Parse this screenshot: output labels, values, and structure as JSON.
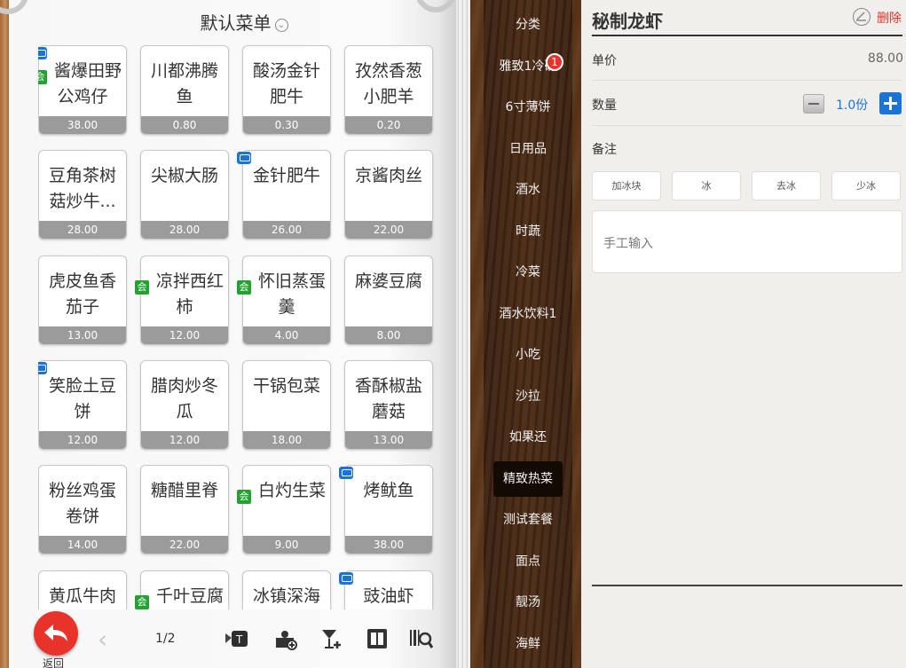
{
  "menu": {
    "title": "默认菜单"
  },
  "dishes": [
    {
      "name": "酱爆田野公鸡仔",
      "price": "38.00",
      "blue": true,
      "green": true
    },
    {
      "name": "川都沸腾鱼",
      "price": "0.80",
      "blue": false,
      "green": false
    },
    {
      "name": "酸汤金针肥牛",
      "price": "0.30",
      "blue": false,
      "green": false
    },
    {
      "name": "孜然香葱小肥羊",
      "price": "0.20",
      "blue": false,
      "green": false
    },
    {
      "name": "豆角茶树菇炒牛...",
      "price": "28.00",
      "blue": false,
      "green": false
    },
    {
      "name": "尖椒大肠",
      "price": "28.00",
      "blue": false,
      "green": false
    },
    {
      "name": "金针肥牛",
      "price": "26.00",
      "blue": true,
      "green": false
    },
    {
      "name": "京酱肉丝",
      "price": "22.00",
      "blue": false,
      "green": false
    },
    {
      "name": "虎皮鱼香茄子",
      "price": "13.00",
      "blue": false,
      "green": false
    },
    {
      "name": "凉拌西红柿",
      "price": "12.00",
      "blue": false,
      "green": true
    },
    {
      "name": "怀旧蒸蛋羹",
      "price": "4.00",
      "blue": false,
      "green": true
    },
    {
      "name": "麻婆豆腐",
      "price": "8.00",
      "blue": false,
      "green": false
    },
    {
      "name": "笑脸土豆饼",
      "price": "12.00",
      "blue": true,
      "green": false
    },
    {
      "name": "腊肉炒冬瓜",
      "price": "12.00",
      "blue": false,
      "green": false
    },
    {
      "name": "干锅包菜",
      "price": "18.00",
      "blue": false,
      "green": false
    },
    {
      "name": "香酥椒盐蘑菇",
      "price": "13.00",
      "blue": false,
      "green": false
    },
    {
      "name": "粉丝鸡蛋卷饼",
      "price": "14.00",
      "blue": false,
      "green": false
    },
    {
      "name": "糖醋里脊",
      "price": "22.00",
      "blue": false,
      "green": false
    },
    {
      "name": "白灼生菜",
      "price": "9.00",
      "blue": false,
      "green": true
    },
    {
      "name": "烤鱿鱼",
      "price": "38.00",
      "blue": true,
      "green": false
    },
    {
      "name": "黄瓜牛肉",
      "price": "",
      "blue": false,
      "green": false
    },
    {
      "name": "千叶豆腐",
      "price": "",
      "blue": false,
      "green": true
    },
    {
      "name": "冰镇深海",
      "price": "",
      "blue": false,
      "green": false
    },
    {
      "name": "豉油虾",
      "price": "",
      "blue": true,
      "green": false
    }
  ],
  "member_badge": "会",
  "toolbar": {
    "back_label": "返回",
    "prev_icon": "chevron-left-icon",
    "pager": "1/2"
  },
  "categories": [
    {
      "label": "分类",
      "active": false
    },
    {
      "label": "雅致1冷碟",
      "active": false
    },
    {
      "label": "6寸薄饼",
      "active": false
    },
    {
      "label": "日用品",
      "active": false
    },
    {
      "label": "酒水",
      "active": false
    },
    {
      "label": "时蔬",
      "active": false
    },
    {
      "label": "冷菜",
      "active": false
    },
    {
      "label": "酒水饮料1",
      "active": false
    },
    {
      "label": "小吃",
      "active": false
    },
    {
      "label": "沙拉",
      "active": false
    },
    {
      "label": "如果还",
      "active": false
    },
    {
      "label": "精致热菜",
      "active": true
    },
    {
      "label": "测试套餐",
      "active": false
    },
    {
      "label": "面点",
      "active": false
    },
    {
      "label": "靓汤",
      "active": false
    },
    {
      "label": "海鲜",
      "active": false
    }
  ],
  "category_badge": "1",
  "detail": {
    "dish_name": "秘制龙虾",
    "delete_label": "删除",
    "unit_price_label": "单价",
    "unit_price": "88.00",
    "quantity_label": "数量",
    "quantity": "1.0份",
    "remark_label": "备注",
    "remark_options": [
      "加冰块",
      "冰",
      "去冰",
      "少冰"
    ],
    "manual_placeholder": "手工输入"
  },
  "colors": {
    "accent_blue": "#1a73d8",
    "accent_red": "#e8332a",
    "member_green": "#22a230",
    "price_bar": "#9b9b9b"
  }
}
